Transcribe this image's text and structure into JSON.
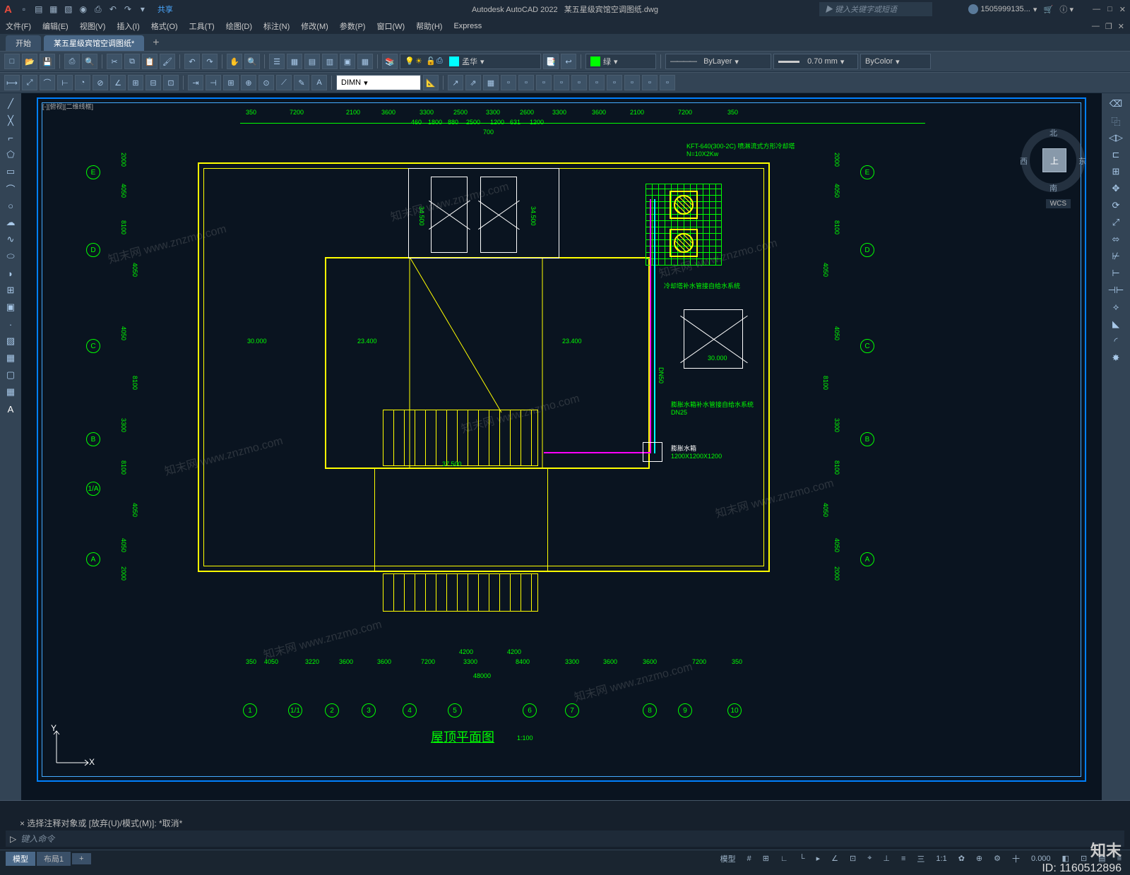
{
  "app": {
    "name": "Autodesk AutoCAD 2022",
    "document": "某五星级宾馆空调图纸.dwg",
    "share": "共享",
    "search_placeholder": "键入关键字或短语",
    "username": "1505999135...",
    "win": {
      "min": "—",
      "max": "□",
      "close": "✕"
    }
  },
  "menu": [
    "文件(F)",
    "编辑(E)",
    "视图(V)",
    "插入(I)",
    "格式(O)",
    "工具(T)",
    "绘图(D)",
    "标注(N)",
    "修改(M)",
    "参数(P)",
    "窗口(W)",
    "帮助(H)",
    "Express"
  ],
  "doc_tabs": {
    "start": "开始",
    "active": "某五星级宾馆空调图纸*",
    "add": "+"
  },
  "toolbar": {
    "layer_name": "孟华",
    "color_name": "绿",
    "linetype": "ByLayer",
    "lineweight": "0.70 mm",
    "plotstyle": "ByColor",
    "dimstyle": "DIMN"
  },
  "viewcube": {
    "top": "上",
    "n": "北",
    "e": "东",
    "s": "南",
    "w": "西",
    "wcs": "WCS"
  },
  "drawing": {
    "viewport_label": "[-][俯视][二维线框]",
    "title": "屋顶平面图",
    "scale_note": "1:100",
    "grids_h": [
      "A",
      "1/A",
      "B",
      "C",
      "D",
      "E"
    ],
    "grids_v": [
      "1",
      "1/1",
      "2",
      "3",
      "4",
      "5",
      "6",
      "7",
      "8",
      "9",
      "10"
    ],
    "dims_top": [
      "350",
      "7200",
      "2100",
      "3600",
      "3300",
      "2500",
      "3300",
      "2600",
      "3300",
      "3600",
      "2100",
      "7200",
      "350"
    ],
    "dims_top2": [
      "460",
      "1800",
      "880",
      "2500",
      "1200",
      "631",
      "1200"
    ],
    "dim_top_small": "700",
    "dims_bottom": [
      "350",
      "4050",
      "3220",
      "3600",
      "3600",
      "7200",
      "3300",
      "8400",
      "3300",
      "3600",
      "3600",
      "7200",
      "350"
    ],
    "dim_bottom_total": "48000",
    "dim_bottom_mid": [
      "4200",
      "4200"
    ],
    "dims_side": [
      "2000",
      "4050",
      "4050",
      "8100",
      "3300",
      "8100",
      "4050",
      "4050",
      "8100",
      "4050",
      "2000"
    ],
    "elevations": [
      "30.000",
      "23.400",
      "23.400",
      "34.500",
      "34.500",
      "37.500",
      "30.000"
    ],
    "equip1_line1": "KFT-640(300-2C) 喷淋流式方形冷却塔",
    "equip1_line2": "N=10X2Kw",
    "equip2": "冷却塔补水管接自给水系统",
    "equip3_line1": "膨胀水箱补水管接自给水系统",
    "equip3_line2": "DN25",
    "equip4_line1": "膨胀水箱",
    "equip4_line2": "1200X1200X1200",
    "pipe_label": "DN50"
  },
  "cmd": {
    "history": "选择注释对象或  [放弃(U)/模式(M)]:  *取消*",
    "prompt_icon": "▷",
    "prompt": "键入命令"
  },
  "status": {
    "model": "模型",
    "layout": "布局1",
    "add": "+",
    "right": [
      "模型",
      "#",
      "⊞",
      "∟",
      "└",
      "▸",
      "∠",
      "⊡",
      "⌖",
      "⊥",
      "≡",
      "三",
      "1:1",
      "✿",
      "⊕",
      "⚙",
      "十",
      "0.000",
      "◧",
      "⊡",
      "▤",
      "≡"
    ]
  },
  "watermark": {
    "text": "知末网 www.znzmo.com",
    "logo": "知末",
    "id": "ID: 1160512896"
  },
  "ucs": {
    "x": "X",
    "y": "Y"
  }
}
